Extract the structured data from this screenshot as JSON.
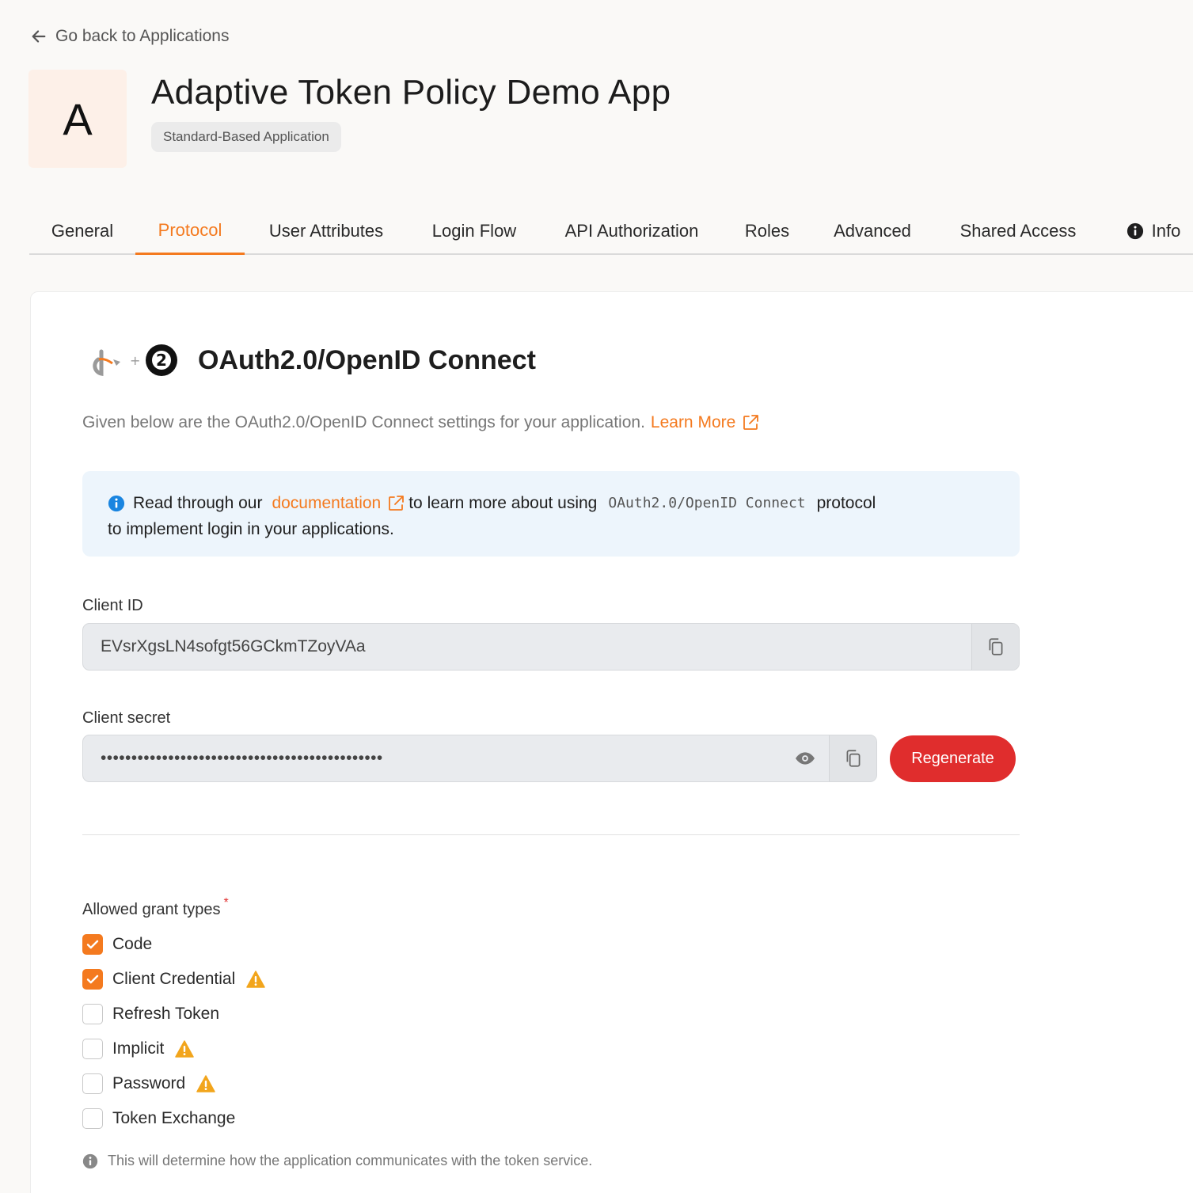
{
  "nav": {
    "back_label": "Go back to Applications"
  },
  "app": {
    "avatar_letter": "A",
    "title": "Adaptive Token Policy Demo App",
    "type_badge": "Standard-Based Application"
  },
  "tabs": [
    {
      "label": "General",
      "active": false
    },
    {
      "label": "Protocol",
      "active": true
    },
    {
      "label": "User Attributes",
      "active": false
    },
    {
      "label": "Login Flow",
      "active": false
    },
    {
      "label": "API Authorization",
      "active": false
    },
    {
      "label": "Roles",
      "active": false
    },
    {
      "label": "Advanced",
      "active": false
    },
    {
      "label": "Shared Access",
      "active": false
    },
    {
      "label": "Info",
      "active": false,
      "icon": "info-icon"
    }
  ],
  "protocol": {
    "title": "OAuth2.0/OpenID Connect",
    "description": "Given below are the OAuth2.0/OpenID Connect settings for your application.",
    "learn_more": "Learn More",
    "logo_number": "2",
    "logo_plus": "+"
  },
  "notice": {
    "prefix": "Read through our",
    "link": "documentation",
    "middle": "to learn more about using",
    "code": "OAuth2.0/OpenID Connect",
    "suffix": "protocol",
    "line2": "to implement login in your applications."
  },
  "client_id": {
    "label": "Client ID",
    "value": "EVsrXgsLN4sofgt56GCkmTZoyVAa"
  },
  "client_secret": {
    "label": "Client secret",
    "masked_value": "••••••••••••••••••••••••••••••••••••••••••••••",
    "regenerate_label": "Regenerate"
  },
  "grant_types": {
    "label": "Allowed grant types",
    "required_mark": "*",
    "options": [
      {
        "label": "Code",
        "checked": true,
        "warning": false
      },
      {
        "label": "Client Credential",
        "checked": true,
        "warning": true
      },
      {
        "label": "Refresh Token",
        "checked": false,
        "warning": false
      },
      {
        "label": "Implicit",
        "checked": false,
        "warning": true
      },
      {
        "label": "Password",
        "checked": false,
        "warning": true
      },
      {
        "label": "Token Exchange",
        "checked": false,
        "warning": false
      }
    ],
    "hint": "This will determine how the application communicates with the token service."
  },
  "colors": {
    "accent": "#f47a1f",
    "danger": "#e02d2d",
    "info_blue": "#1a85e0",
    "warning": "#f2a51c"
  }
}
